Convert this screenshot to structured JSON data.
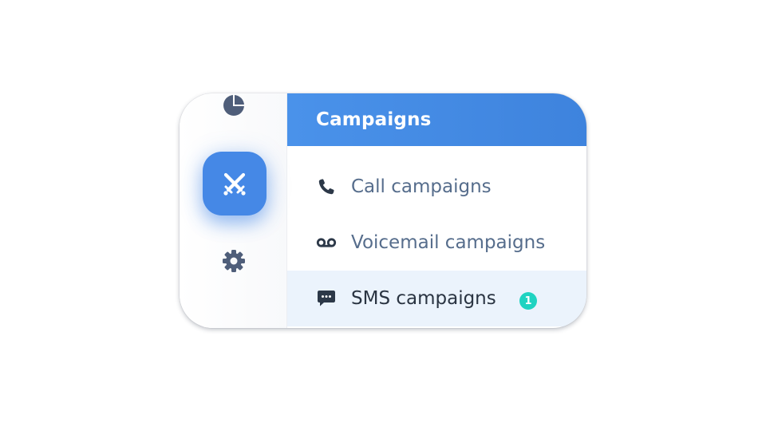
{
  "rail": {
    "icons": [
      {
        "name": "pie-chart-icon",
        "active": false
      },
      {
        "name": "crossed-swords-icon",
        "active": true
      },
      {
        "name": "gear-icon",
        "active": false
      }
    ],
    "accent_color": "#4588e6"
  },
  "panel": {
    "title": "Campaigns",
    "header_color": "#4a92ea",
    "items": [
      {
        "label": "Call campaigns",
        "icon": "phone-icon",
        "selected": false
      },
      {
        "label": "Voicemail campaigns",
        "icon": "voicemail-icon",
        "selected": false
      },
      {
        "label": "SMS campaigns",
        "icon": "chat-bubble-icon",
        "selected": true,
        "badge": "1"
      }
    ],
    "selected_bg": "#ebf3fc",
    "badge_color": "#1fd3c1"
  }
}
